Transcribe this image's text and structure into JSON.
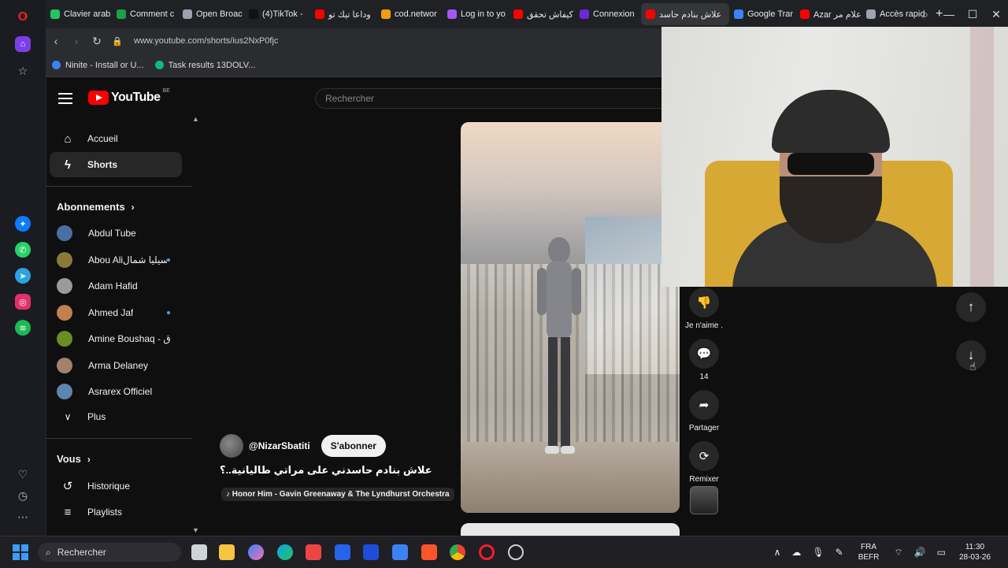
{
  "browser": {
    "tabs": [
      {
        "label": "Clavier arab",
        "color": "#22c55e"
      },
      {
        "label": "Comment c",
        "color": "#16a34a"
      },
      {
        "label": "Open Broac",
        "color": "#9ca3af"
      },
      {
        "label": "(4)TikTok - ",
        "color": "#111111"
      },
      {
        "label": "وداعا تيك تو",
        "color": "#ff0000"
      },
      {
        "label": "cod.networ",
        "color": "#f59e0b"
      },
      {
        "label": "Log in to yo",
        "color": "#a855f7"
      },
      {
        "label": "كيفاش تحقق",
        "color": "#ff0000"
      },
      {
        "label": "Connexion",
        "color": "#6d28d9"
      },
      {
        "label": "علاش بنادم حاسد",
        "color": "#ff0000"
      },
      {
        "label": "Google Trar",
        "color": "#3b82f6"
      },
      {
        "label": "Azar علام مر",
        "color": "#ff0000"
      },
      {
        "label": "Accès rapid",
        "color": "#9ca3af"
      }
    ],
    "active_tab_index": 9,
    "url": "www.youtube.com/shorts/ius2NxP0fjc",
    "bookmarks": [
      {
        "label": "Ninite - Install or U...",
        "color": "#3b82f6"
      },
      {
        "label": "Task results 13DOLV...",
        "color": "#10b981"
      }
    ],
    "new_tab_symbol": "+",
    "window_controls": {
      "search": "⌕",
      "minimize": "—",
      "maximize": "☐",
      "close": "✕"
    }
  },
  "youtube": {
    "logo_text": "YouTube",
    "country_code": "BE",
    "search_placeholder": "Rechercher",
    "nav": [
      {
        "label": "Accueil",
        "icon": "home-icon"
      },
      {
        "label": "Shorts",
        "icon": "shorts-icon"
      }
    ],
    "subscriptions_header": "Abonnements",
    "subscriptions": [
      {
        "name": "Abdul Tube",
        "live": false,
        "color": "#4a6fa5"
      },
      {
        "name": "Abou Aliإسيليا شمال",
        "live": true,
        "color": "#8a7a3a"
      },
      {
        "name": "Adam Hafid",
        "live": false,
        "color": "#9a9a9a"
      },
      {
        "name": "Ahmed Jaf",
        "live": true,
        "color": "#c08050"
      },
      {
        "name": "Amine Boushaq - ق",
        "live": false,
        "color": "#6b8e23"
      },
      {
        "name": "Arma Delaney",
        "live": false,
        "color": "#a0826d"
      },
      {
        "name": "Asrarex Officiel",
        "live": false,
        "color": "#5a86b0"
      }
    ],
    "more_label": "Plus",
    "you_header": "Vous",
    "you_items": [
      {
        "label": "Historique",
        "icon": "history-icon"
      },
      {
        "label": "Playlists",
        "icon": "playlists-icon"
      }
    ],
    "short": {
      "channel_handle": "@NizarSbatiti",
      "subscribe_label": "S'abonner",
      "title": "علاش بنادم حاسدني على مراتي طاليانية..؟",
      "music": "Honor Him - Gavin Greenaway & The Lyndhurst Orchestra",
      "actions": [
        {
          "icon": "dislike-icon",
          "glyph": "👎",
          "label": "Je n'aime ."
        },
        {
          "icon": "comment-icon",
          "glyph": "💬",
          "label": "14"
        },
        {
          "icon": "share-icon",
          "glyph": "➦",
          "label": "Partager"
        },
        {
          "icon": "remix-icon",
          "glyph": "⟳",
          "label": "Remixer"
        }
      ]
    },
    "nav_up_glyph": "↑",
    "nav_down_glyph": "↓"
  },
  "taskbar": {
    "search_placeholder": "Rechercher",
    "language": "FRA",
    "keyboard_layout": "BEFR",
    "time": "11:30",
    "date": "28-03-26"
  }
}
